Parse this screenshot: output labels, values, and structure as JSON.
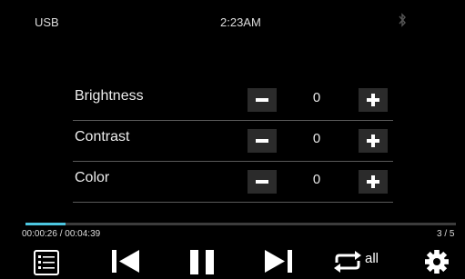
{
  "status_bar": {
    "source": "USB",
    "time": "2:23AM",
    "bluetooth_icon": "bluetooth-icon"
  },
  "settings": [
    {
      "label": "Brightness",
      "value": "0"
    },
    {
      "label": "Contrast",
      "value": "0"
    },
    {
      "label": "Color",
      "value": "0"
    }
  ],
  "playback": {
    "elapsed_total": "00:00:26 / 00:04:39",
    "track_count": "3 / 5",
    "progress_fraction": 0.093
  },
  "controls": {
    "playlist_icon": "playlist-icon",
    "previous_icon": "previous-icon",
    "pause_icon": "pause-icon",
    "next_icon": "next-icon",
    "repeat_icon": "repeat-icon",
    "repeat_label": "all",
    "settings_icon": "gear-icon"
  },
  "colors": {
    "accent": "#4cc6e0",
    "background": "#000000",
    "button_bg": "#2b2b2b"
  }
}
